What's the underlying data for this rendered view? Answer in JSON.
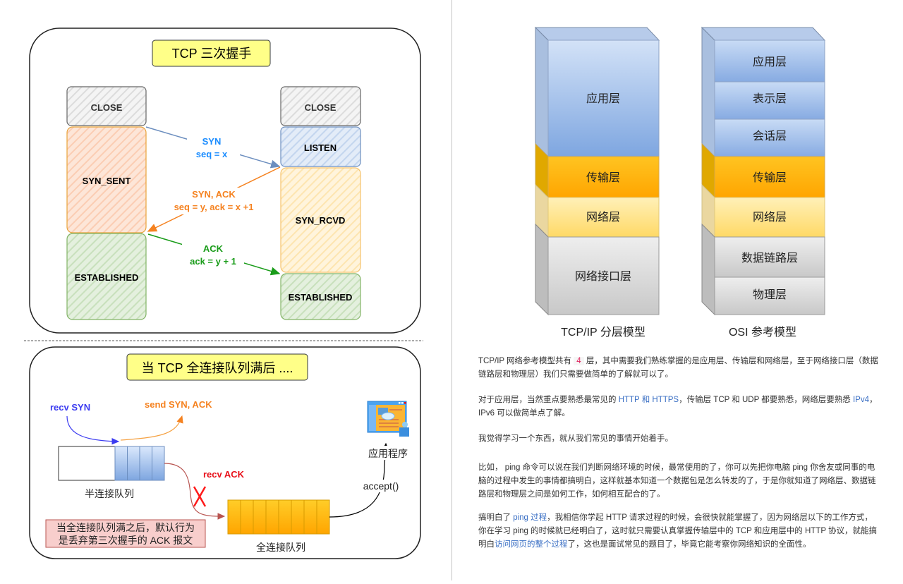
{
  "handshake": {
    "title": "TCP 三次握手",
    "client_states": [
      "CLOSE",
      "SYN_SENT",
      "ESTABLISHED"
    ],
    "server_states": [
      "CLOSE",
      "LISTEN",
      "SYN_RCVD",
      "ESTABLISHED"
    ],
    "msg1": {
      "line1": "SYN",
      "line2": "seq = x",
      "color": "#1a8cff"
    },
    "msg2": {
      "line1": "SYN, ACK",
      "line2": "seq = y, ack = x +1",
      "color": "#f58220"
    },
    "msg3": {
      "line1": "ACK",
      "line2": "ack = y + 1",
      "color": "#1a9c1a"
    }
  },
  "queue": {
    "title": "当 TCP 全连接队列满后 ....",
    "recv_syn": "recv SYN",
    "send_synack": "send SYN, ACK",
    "recv_ack": "recv ACK",
    "half_queue_label": "半连接队列",
    "full_queue_label": "全连接队列",
    "app_label": "应用程序",
    "accept_label": "accept()",
    "note_line1": "当全连接队列满之后，默认行为",
    "note_line2": "是丢弃第三次握手的 ACK 报文"
  },
  "models": {
    "tcpip": {
      "caption": "TCP/IP 分层模型",
      "layers": [
        "应用层",
        "传输层",
        "网络层",
        "网络接口层"
      ]
    },
    "osi": {
      "caption": "OSI 参考模型",
      "layers": [
        "应用层",
        "表示层",
        "会话层",
        "传输层",
        "网络层",
        "数据链路层",
        "物理层"
      ]
    }
  },
  "article": {
    "p1": {
      "a": "TCP/IP 网络参考模型共有 ",
      "code": "4",
      "b": " 层，其中需要我们熟练掌握的是应用层、传输层和网络层，至于网络接口层（数据链路层和物理层）我们只需要做简单的了解就可以了。"
    },
    "p2": {
      "a": "对于应用层，当然重点要熟悉最常见的 ",
      "link1": "HTTP 和 HTTPS",
      "b": "，传输层 TCP 和 UDP 都要熟悉，网络层要熟悉 ",
      "link2": "IPv4",
      "c": "，IPv6 可以做简单点了解。"
    },
    "p3": "我觉得学习一个东西，就从我们常见的事情开始着手。",
    "p4": "比如， ping 命令可以说在我们判断网络环境的时候，最常使用的了，你可以先把你电脑 ping 你舍友或同事的电脑的过程中发生的事情都搞明白，这样就基本知道一个数据包是怎么转发的了，于是你就知道了网络层、数据链路层和物理层之间是如何工作，如何相互配合的了。",
    "p5": {
      "a": "搞明白了 ",
      "link1": "ping 过程",
      "b": "，我相信你学起 HTTP 请求过程的时候，会很快就能掌握了，因为网络层以下的工作方式，你在学习 ping 的时候就已经明白了，这时就只需要认真掌握传输层中的 TCP 和应用层中的 HTTP 协议，就能搞明白",
      "link2": "访问网页的整个过程",
      "c": "了，这也是面试常见的题目了，毕竟它能考察你网络知识的全面性。"
    }
  }
}
